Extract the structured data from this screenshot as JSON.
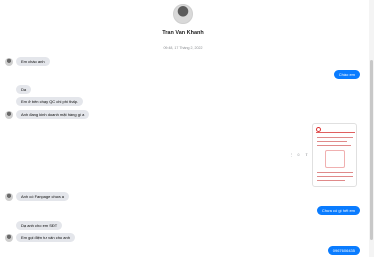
{
  "contact": {
    "name": "Tran Van Khanh"
  },
  "timestamp": "09:48, 17 Tháng 2, 2022",
  "messages": [
    {
      "text": "Em chào anh"
    },
    {
      "text": "Chào em"
    },
    {
      "text": "Da"
    },
    {
      "text": "Em ở bên chạy QC chi phí thấp."
    },
    {
      "text": "Anh đang kinh doanh mặt hàng gì a"
    },
    {
      "text": "Anh có Fanpage chưa a"
    },
    {
      "text": "Chưa có gì hết em"
    },
    {
      "text": "Dạ anh cho em SĐT"
    },
    {
      "text": "Em gọi điện tư vấn cho anh"
    },
    {
      "text": "0967606435"
    }
  ],
  "actions": {
    "more_icon": "⋮",
    "reaction_icon": "☺",
    "share_icon": "⇪"
  },
  "colors": {
    "outgoing_bubble": "#0a7cff",
    "incoming_bubble": "#e4e6eb"
  }
}
